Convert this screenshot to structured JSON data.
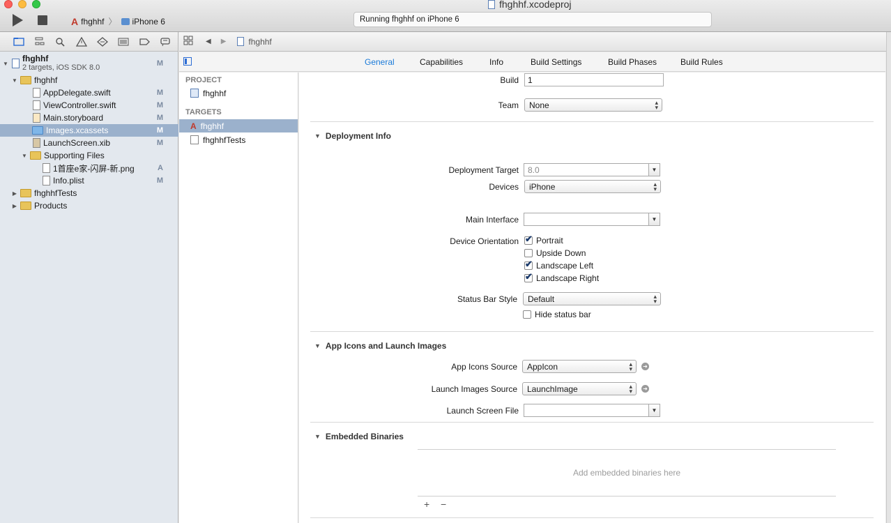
{
  "window": {
    "title": "fhghhf.xcodeproj",
    "activity": "Running fhghhf on iPhone 6"
  },
  "toolbar": {
    "scheme": "fhghhf",
    "destination": "iPhone 6"
  },
  "navigator": {
    "tabs": [
      "folder-icon",
      "hierarchy-icon",
      "search-icon",
      "warning-icon",
      "test-icon",
      "debug-icon",
      "breakpoint-icon",
      "report-icon"
    ],
    "tree": [
      {
        "name": "fhghhf",
        "subtitle": "2 targets, iOS SDK 8.0",
        "status": "M",
        "kind": "project"
      },
      {
        "name": "fhghhf",
        "status": "",
        "kind": "folder"
      },
      {
        "name": "AppDelegate.swift",
        "status": "M",
        "kind": "file"
      },
      {
        "name": "ViewController.swift",
        "status": "M",
        "kind": "file"
      },
      {
        "name": "Main.storyboard",
        "status": "M",
        "kind": "file"
      },
      {
        "name": "Images.xcassets",
        "status": "M",
        "kind": "file",
        "selected": true
      },
      {
        "name": "LaunchScreen.xib",
        "status": "M",
        "kind": "file"
      },
      {
        "name": "Supporting Files",
        "status": "",
        "kind": "folder"
      },
      {
        "name": "1首座e家-闪屏-新.png",
        "status": "A",
        "kind": "file"
      },
      {
        "name": "Info.plist",
        "status": "M",
        "kind": "file"
      },
      {
        "name": "fhghhfTests",
        "status": "",
        "kind": "folder"
      },
      {
        "name": "Products",
        "status": "",
        "kind": "folder"
      }
    ]
  },
  "jumpbar": {
    "item": "fhghhf"
  },
  "editor_tabs": {
    "general": "General",
    "capabilities": "Capabilities",
    "info": "Info",
    "build_settings": "Build Settings",
    "build_phases": "Build Phases",
    "build_rules": "Build Rules"
  },
  "targets_list": {
    "project_header": "PROJECT",
    "project_item": "fhghhf",
    "targets_header": "TARGETS",
    "target_app": "fhghhf",
    "target_tests": "fhghhfTests"
  },
  "identity": {
    "build_label": "Build",
    "build_value": "1",
    "team_label": "Team",
    "team_value": "None"
  },
  "deployment": {
    "title": "Deployment Info",
    "target_label": "Deployment Target",
    "target_value": "8.0",
    "devices_label": "Devices",
    "devices_value": "iPhone",
    "main_interface_label": "Main Interface",
    "main_interface_value": "",
    "orientation_label": "Device Orientation",
    "portrait": "Portrait",
    "portrait_checked": true,
    "upside_down": "Upside Down",
    "upside_down_checked": false,
    "landscape_left": "Landscape Left",
    "landscape_left_checked": true,
    "landscape_right": "Landscape Right",
    "landscape_right_checked": true,
    "status_bar_label": "Status Bar Style",
    "status_bar_value": "Default",
    "hide_status_bar": "Hide status bar",
    "hide_status_bar_checked": false
  },
  "app_icons": {
    "title": "App Icons and Launch Images",
    "icons_source_label": "App Icons Source",
    "icons_source_value": "AppIcon",
    "launch_images_label": "Launch Images Source",
    "launch_images_value": "LaunchImage",
    "launch_screen_label": "Launch Screen File",
    "launch_screen_value": ""
  },
  "embedded": {
    "title": "Embedded Binaries",
    "empty_text": "Add embedded binaries here",
    "add": "+",
    "remove": "−"
  }
}
